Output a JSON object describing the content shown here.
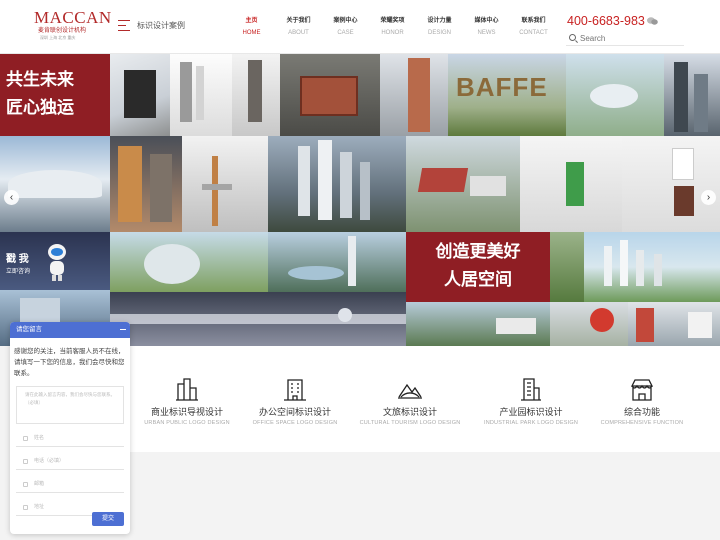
{
  "header": {
    "logo_text": "MACCAN",
    "logo_cn": "麦肯联创设计机构",
    "logo_sub": "深圳 上海 北京 重庆",
    "slogan": "标识设计案例",
    "phone": "400-6683-983",
    "search_placeholder": "Search"
  },
  "nav": [
    {
      "cn": "主页",
      "en": "HOME",
      "active": true
    },
    {
      "cn": "关于我们",
      "en": "ABOUT"
    },
    {
      "cn": "案例中心",
      "en": "CASE"
    },
    {
      "cn": "荣耀奖项",
      "en": "HONOR"
    },
    {
      "cn": "设计力量",
      "en": "DESIGN"
    },
    {
      "cn": "媒体中心",
      "en": "NEWS"
    },
    {
      "cn": "联系我们",
      "en": "CONTACT"
    }
  ],
  "banner": {
    "slogan_1": "共生未来",
    "slogan_2": "匠心独运",
    "slogan_3": "创造更美好",
    "slogan_4": "人居空间",
    "robot_1": "戳 我",
    "robot_2": "立即咨询",
    "sign_text": "BAFFE"
  },
  "services": [
    {
      "title": "商业标识导视设计",
      "en": "URBAN PUBLIC LOGO DESIGN",
      "icon": "city-buildings-icon"
    },
    {
      "title": "办公空间标识设计",
      "en": "OFFICE SPACE LOGO DESIGN",
      "icon": "office-building-icon"
    },
    {
      "title": "文旅标识设计",
      "en": "CULTURAL TOURISM LOGO DESIGN",
      "icon": "mountain-frame-icon"
    },
    {
      "title": "产业园标识设计",
      "en": "INDUSTRIAL PARK LOGO DESIGN",
      "icon": "factory-icon"
    },
    {
      "title": "综合功能",
      "en": "COMPREHENSIVE FUNCTION",
      "icon": "shop-icon"
    }
  ],
  "chat": {
    "header": "请您留言",
    "message": "感谢您的关注，当前客服人员不在线，请填写一下您的信息，我们会尽快和您联系。",
    "textarea_placeholder": "请在此输入留言内容，我们会尽快与您联系。（必填）",
    "name_placeholder": "姓名",
    "phone_placeholder": "电话（必填）",
    "email_placeholder": "邮箱",
    "address_placeholder": "地址",
    "submit": "提交"
  },
  "colors": {
    "brand": "#c82222",
    "chat": "#4d6fd3"
  }
}
